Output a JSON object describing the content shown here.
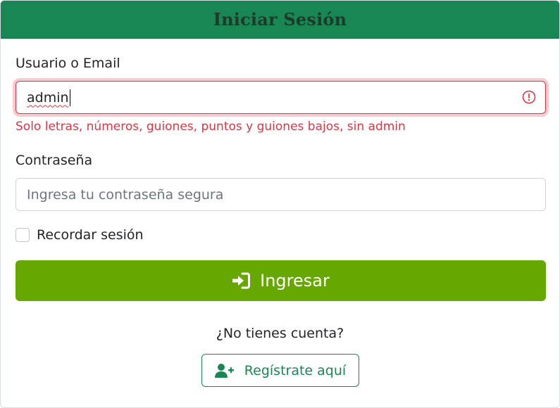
{
  "header": {
    "title": "Iniciar Sesión"
  },
  "username": {
    "label": "Usuario o Email",
    "value": "admin",
    "error": "Solo letras, números, guiones, puntos y guiones bajos, sin admin"
  },
  "password": {
    "label": "Contraseña",
    "placeholder": "Ingresa tu contraseña segura"
  },
  "remember": {
    "label": "Recordar sesión",
    "checked": false
  },
  "submit": {
    "label": "Ingresar",
    "icon": "sign-in-icon"
  },
  "register": {
    "prompt": "¿No tienes cuenta?",
    "label": "Regístrate aquí",
    "icon": "user-plus-icon"
  },
  "colors": {
    "header_bg": "#198754",
    "error": "#dc3545",
    "submit_bg": "#66a800",
    "register_accent": "#198754"
  }
}
